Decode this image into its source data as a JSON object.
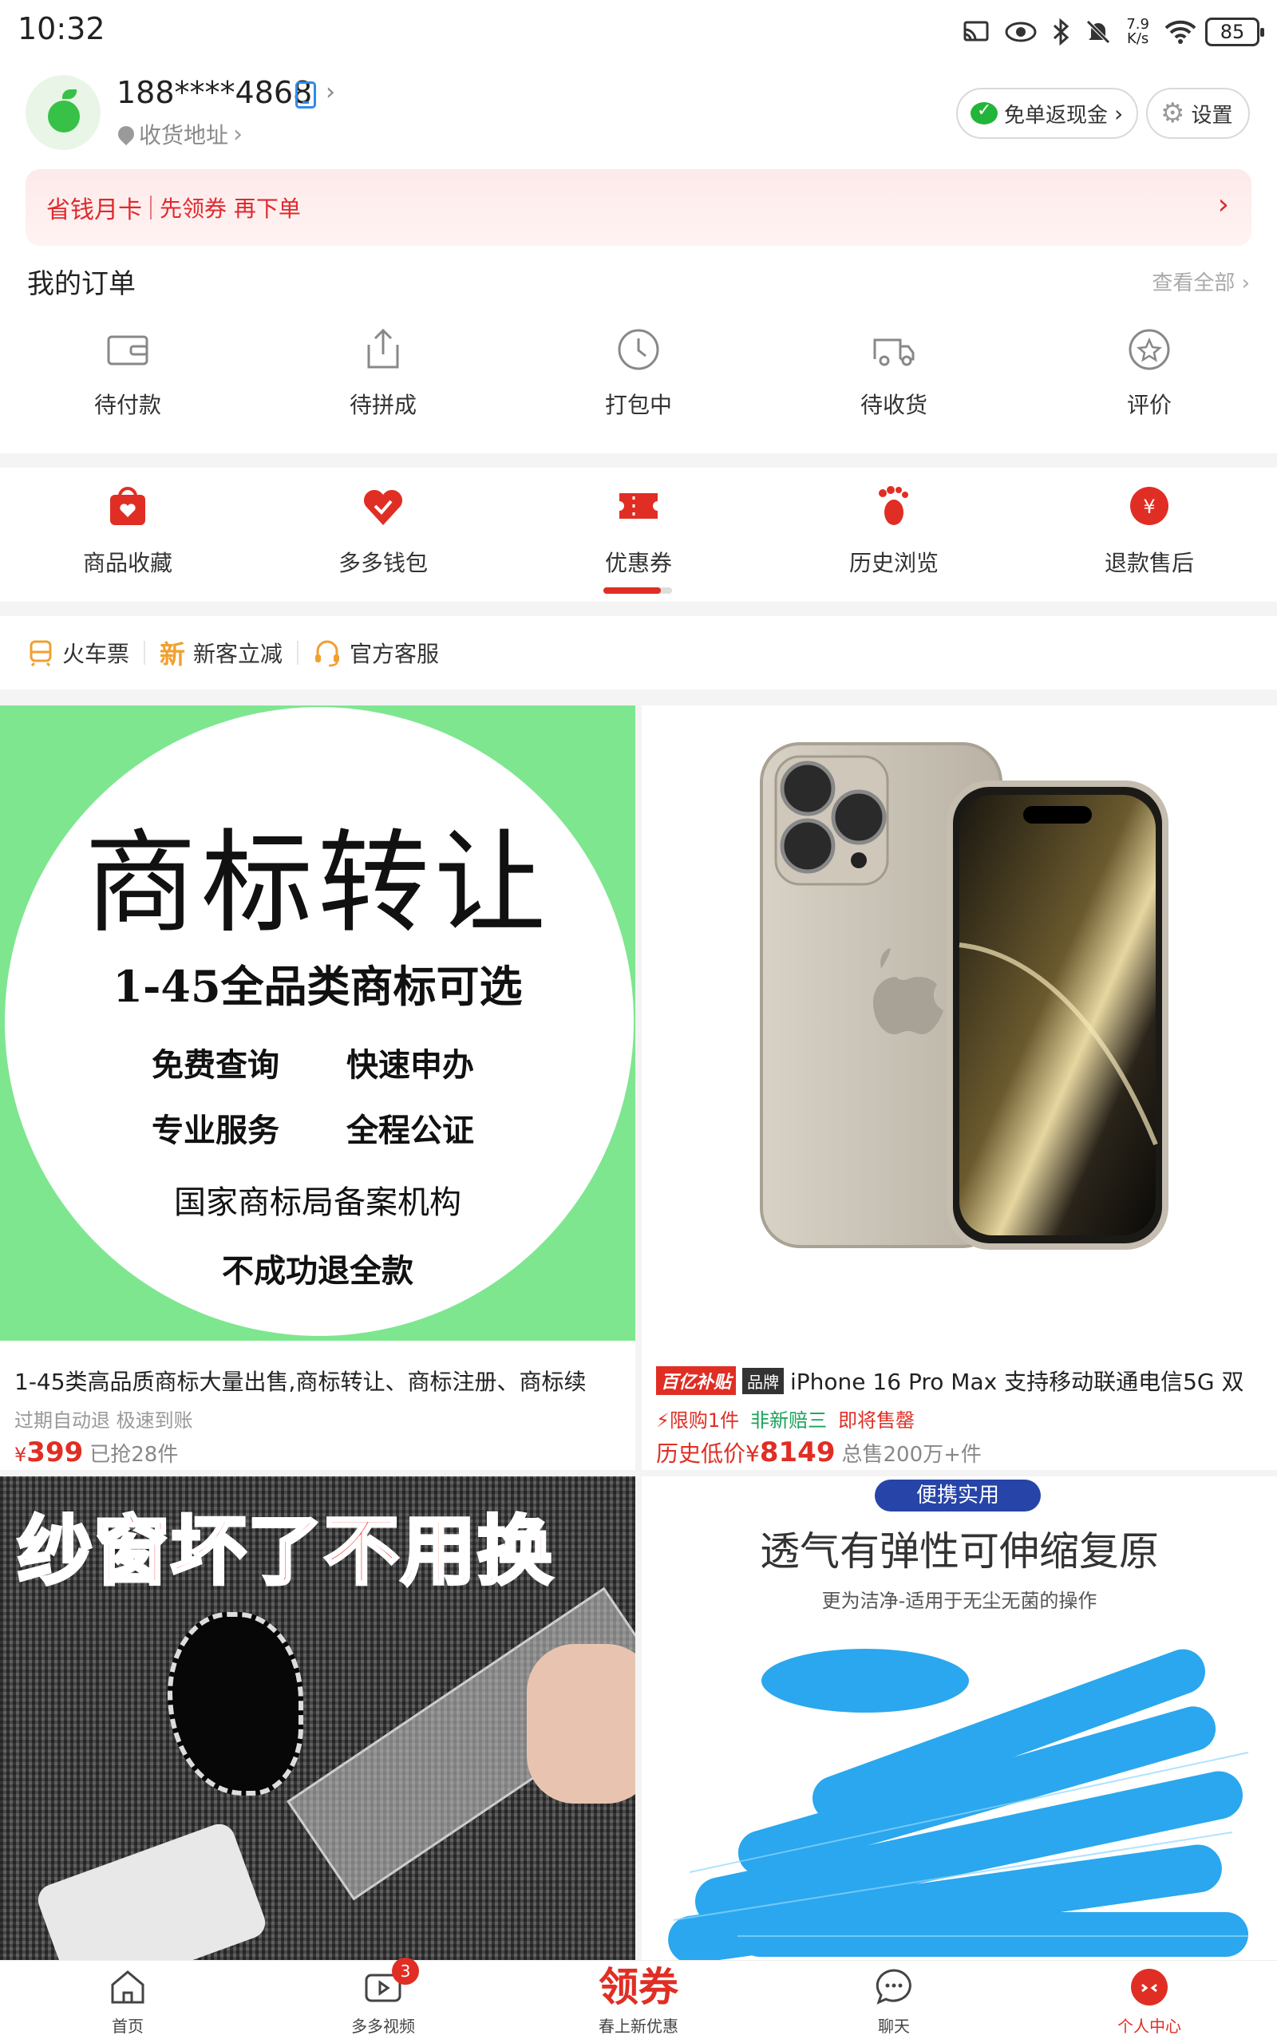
{
  "status_bar": {
    "time": "10:32",
    "net_speed_value": "7.9",
    "net_speed_unit": "K/s",
    "battery": "85"
  },
  "profile": {
    "phone": "188****4868",
    "address_label": "收货地址",
    "cashback_label": "免单返现金",
    "settings_label": "设置"
  },
  "banner": {
    "title": "省钱月卡",
    "subtitle": "先领券 再下单"
  },
  "orders": {
    "title": "我的订单",
    "view_all": "查看全部",
    "items": [
      {
        "label": "待付款",
        "icon": "wallet-icon"
      },
      {
        "label": "待拼成",
        "icon": "share-icon"
      },
      {
        "label": "打包中",
        "icon": "clock-icon"
      },
      {
        "label": "待收货",
        "icon": "truck-icon"
      },
      {
        "label": "评价",
        "icon": "star-badge-icon"
      }
    ]
  },
  "tools": {
    "items": [
      {
        "label": "商品收藏",
        "icon": "shopping-bag-heart-icon"
      },
      {
        "label": "多多钱包",
        "icon": "heart-wallet-icon"
      },
      {
        "label": "优惠券",
        "icon": "ticket-icon"
      },
      {
        "label": "历史浏览",
        "icon": "footprint-icon"
      },
      {
        "label": "退款售后",
        "icon": "refund-icon"
      }
    ],
    "accent_color": "#e02e24"
  },
  "services": [
    {
      "label": "火车票",
      "icon": "train-icon"
    },
    {
      "label": "新客立减",
      "icon": "new-tag-icon",
      "icon_text": "新"
    },
    {
      "label": "官方客服",
      "icon": "headset-icon"
    }
  ],
  "products": [
    {
      "title": "1-45类高品质商标大量出售,商标转让、商标注册、商标续",
      "tags": "过期自动退  极速到账",
      "price_symbol": "¥",
      "price": "399",
      "sales": "已抢28件",
      "image": {
        "headline": "商标转让",
        "line1": "1-45全品类商标可选",
        "line2a": "免费查询",
        "line2b": "快速申办",
        "line3a": "专业服务",
        "line3b": "全程公证",
        "line4": "国家商标局备案机构",
        "line5": "不成功退全款"
      }
    },
    {
      "badge1": "百亿补贴",
      "badge2": "品牌",
      "title": "iPhone 16 Pro Max  支持移动联通电信5G 双",
      "tag_limit": "限购1件",
      "tag_green": "非新赔三",
      "tag_red": "即将售罄",
      "price_prefix": "历史低价",
      "price_symbol": "¥",
      "price": "8149",
      "sales": "总售200万+件"
    },
    {
      "image_text": "纱窗坏了不用换"
    },
    {
      "image_badge": "便携实用",
      "image_headline": "透气有弹性可伸缩复原",
      "image_sub": "更为洁净-适用于无尘无菌的操作"
    }
  ],
  "tabbar": {
    "items": [
      {
        "label": "首页",
        "icon": "home-icon"
      },
      {
        "label": "多多视频",
        "icon": "video-icon",
        "badge": "3"
      },
      {
        "label": "春上新优惠",
        "icon": "coupon-text-icon",
        "big_text": "领券"
      },
      {
        "label": "聊天",
        "icon": "chat-icon"
      },
      {
        "label": "个人中心",
        "icon": "profile-icon"
      }
    ]
  }
}
